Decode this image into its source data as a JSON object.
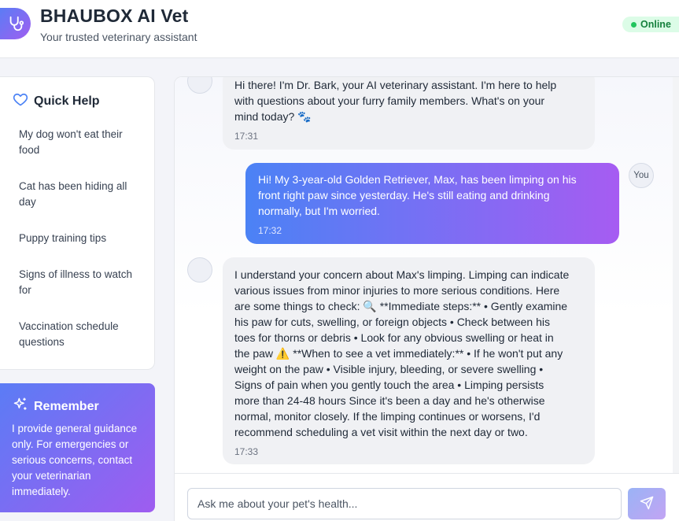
{
  "header": {
    "title": "BHAUBOX AI Vet",
    "subtitle": "Your trusted veterinary assistant",
    "status": "Online",
    "logo_icon": "stethoscope-icon"
  },
  "sidebar": {
    "quick_help": {
      "title": "Quick Help",
      "icon": "heart-icon",
      "items": [
        {
          "label": "My dog won't eat their food"
        },
        {
          "label": "Cat has been hiding all day"
        },
        {
          "label": "Puppy training tips"
        },
        {
          "label": "Signs of illness to watch for"
        },
        {
          "label": "Vaccination schedule questions"
        }
      ]
    },
    "remember": {
      "title": "Remember",
      "icon": "sparkles-icon",
      "text": "I provide general guidance only. For emergencies or serious concerns, contact your veterinarian immediately."
    }
  },
  "chat": {
    "messages": [
      {
        "sender": "bot",
        "lines": [
          "Hi there! I'm Dr. Bark, your AI veterinary assistant. I'm here to help",
          "with questions about your furry family members. What's on your",
          "mind today? 🐾"
        ],
        "time": "17:31"
      },
      {
        "sender": "user",
        "avatar_label": "You",
        "lines": [
          "Hi! My 3-year-old Golden Retriever, Max, has been limping on his",
          "front right paw since yesterday. He's still eating and drinking",
          "normally, but I'm worried."
        ],
        "time": "17:32"
      },
      {
        "sender": "bot",
        "lines": [
          "I understand your concern about Max's limping. Limping can indicate",
          "various issues from minor injuries to more serious conditions. Here",
          "are some things to check: 🔍 **Immediate steps:** • Gently examine",
          "his paw for cuts, swelling, or foreign objects • Check between his",
          "toes for thorns or debris • Look for any obvious swelling or heat in",
          "the paw ⚠️ **When to see a vet immediately:** • If he won't put any",
          "weight on the paw • Visible injury, bleeding, or severe swelling •",
          "Signs of pain when you gently touch the area • Limping persists",
          "more than 24-48 hours Since it's been a day and he's otherwise",
          "normal, monitor closely. If the limping continues or worsens, I'd",
          "recommend scheduling a vet visit within the next day or two."
        ],
        "time": "17:33"
      }
    ],
    "input": {
      "placeholder": "Ask me about your pet's health...",
      "value": ""
    },
    "send_icon": "send-icon"
  },
  "colors": {
    "accent_start": "#4b82f5",
    "accent_end": "#a65cf2",
    "online": "#22c55e"
  }
}
